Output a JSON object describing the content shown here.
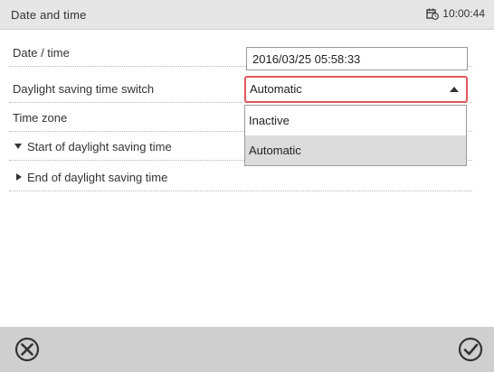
{
  "window": {
    "title": "Date and time",
    "clock": "10:00:44"
  },
  "rows": [
    {
      "label": "Date / time"
    },
    {
      "label": "Daylight saving time switch"
    },
    {
      "label": "Time zone"
    },
    {
      "label": "Start of daylight saving time"
    },
    {
      "label": "End of daylight saving time"
    }
  ],
  "fields": {
    "datetime_value": "2016/03/25 05:58:33",
    "dst_switch_value": "Automatic"
  },
  "dropdown": {
    "options": [
      "Inactive",
      "Automatic"
    ],
    "selected": "Automatic"
  },
  "footer": {
    "cancel_icon": "cancel-x-circle-icon",
    "confirm_icon": "confirm-check-circle-icon"
  }
}
